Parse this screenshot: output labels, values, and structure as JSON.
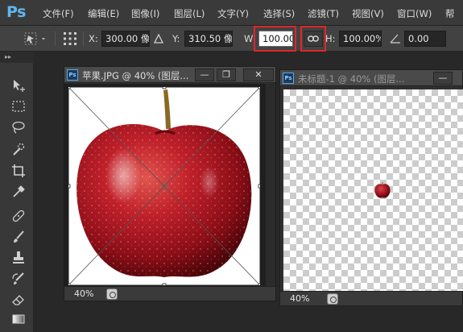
{
  "app": {
    "logo": "Ps"
  },
  "menu": [
    "文件(F)",
    "编辑(E)",
    "图像(I)",
    "图层(L)",
    "文字(Y)",
    "选择(S)",
    "滤镜(T)",
    "视图(V)",
    "窗口(W)",
    "帮"
  ],
  "options": {
    "x_label": "X:",
    "x_value": "300.00 像",
    "y_label": "Y:",
    "y_value": "310.50 像",
    "w_label": "W:",
    "w_value": "100.00%",
    "h_label": "H:",
    "h_value": "100.00%",
    "angle_value": "0.00",
    "link_icon": "link-icon",
    "highlight_color": "#e1262a"
  },
  "documents": [
    {
      "title": "苹果.JPG @ 40% (图层...",
      "zoom": "40%"
    },
    {
      "title": "未标题-1 @ 40% (图层...",
      "zoom": "40%"
    }
  ],
  "window_buttons": {
    "minimize": "—",
    "restore": "❐",
    "close": "✕"
  },
  "tools": [
    "move-tool-icon",
    "marquee-tool-icon",
    "lasso-tool-icon",
    "quick-select-icon",
    "crop-tool-icon",
    "eyedropper-icon",
    "healing-brush-icon",
    "brush-icon",
    "stamp-icon",
    "history-brush-icon",
    "eraser-icon",
    "gradient-icon"
  ]
}
